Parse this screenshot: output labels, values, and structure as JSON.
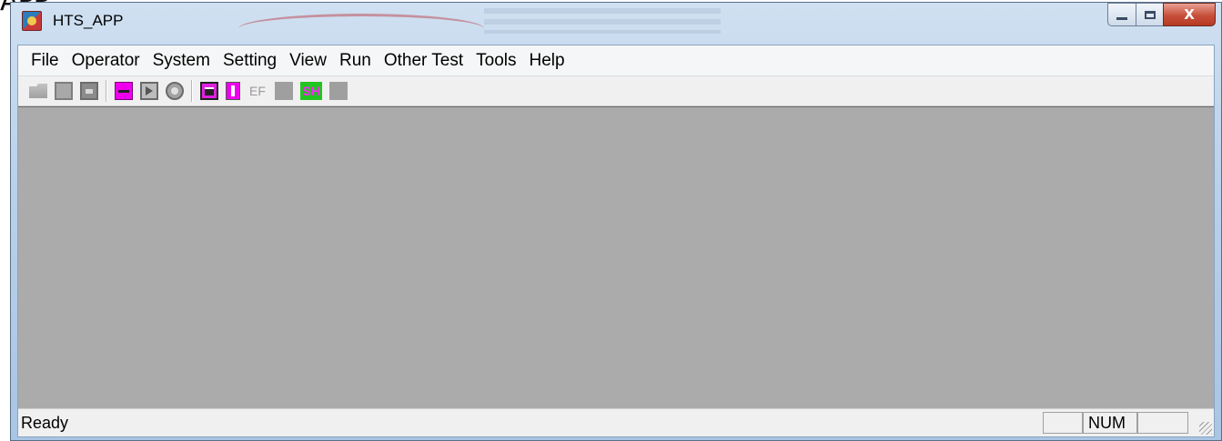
{
  "cut_text": "APP",
  "window": {
    "title": "HTS_APP",
    "close_symbol": "X"
  },
  "menu": [
    "File",
    "Operator",
    "System",
    "Setting",
    "View",
    "Run",
    "Other Test",
    "Tools",
    "Help"
  ],
  "toolbar": {
    "ef_label": "EF",
    "sh_label": "SH",
    "icons": [
      "open-icon",
      "import-icon",
      "save-icon",
      "key-icon",
      "run-icon",
      "stop-icon",
      "chip-icon",
      "document-icon",
      "ef-icon",
      "blank-icon",
      "sh-icon",
      "blank-icon"
    ]
  },
  "status": {
    "text": "Ready",
    "panes": [
      "",
      "NUM",
      ""
    ]
  },
  "colors": {
    "workspace": "#ababab",
    "accent_magenta": "#ee00ee",
    "accent_green": "#22c422",
    "close_red": "#c74f3a"
  }
}
